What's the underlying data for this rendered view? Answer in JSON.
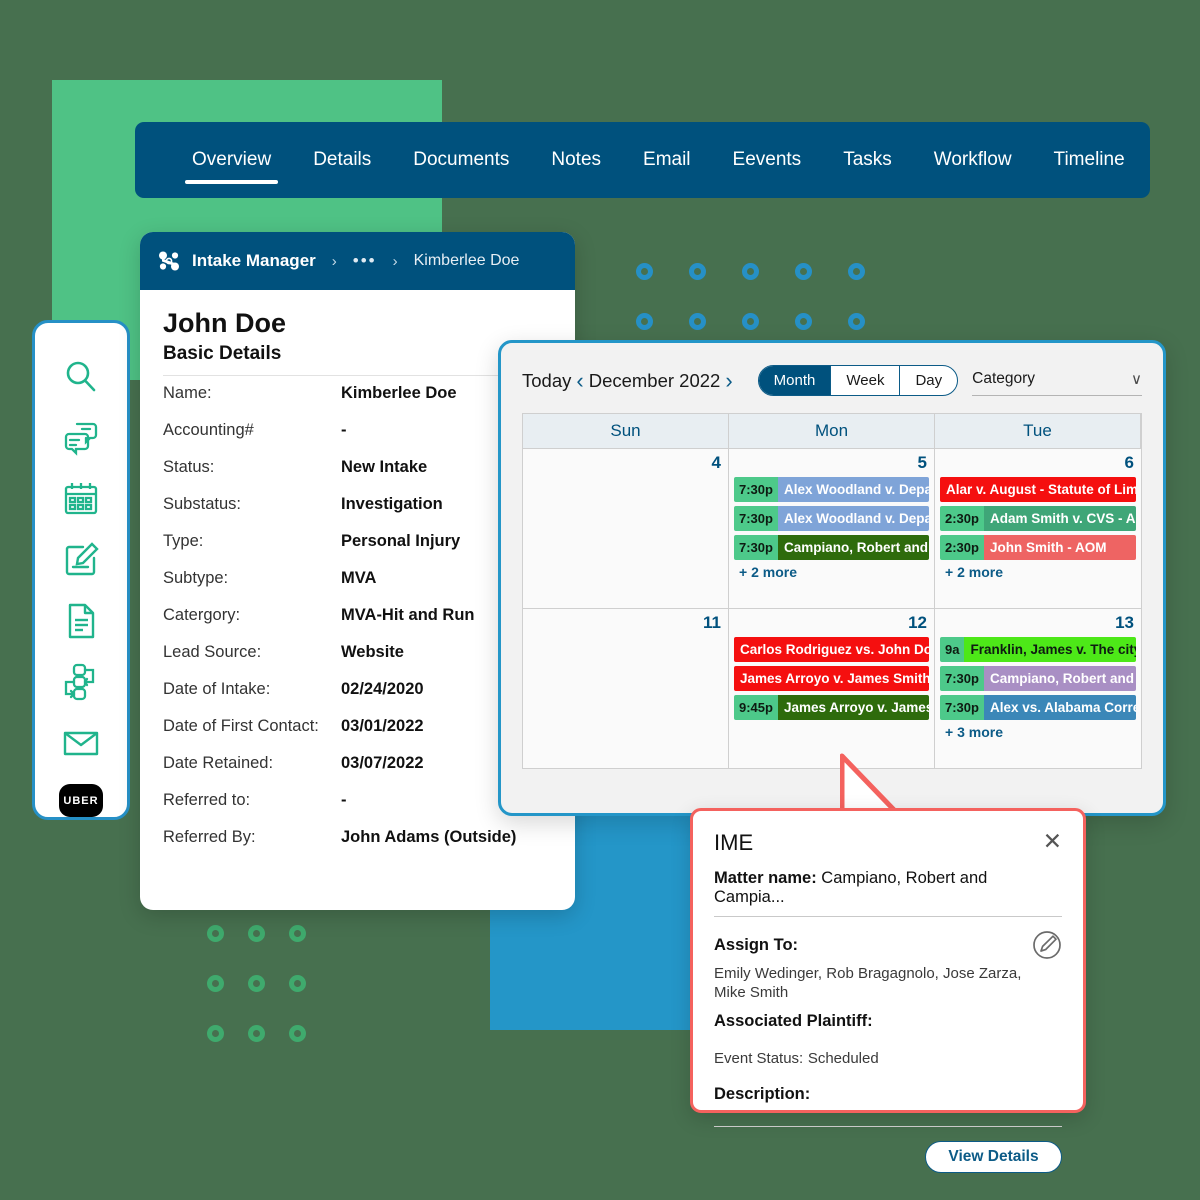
{
  "theme": {
    "page_bg": "#47704F",
    "navy": "#00517D",
    "blue": "#2496C8",
    "green": "#4FC285",
    "coral": "#F4625E",
    "mint": "#4DC98A"
  },
  "tabs": [
    {
      "label": "Overview",
      "active": true
    },
    {
      "label": "Details",
      "active": false
    },
    {
      "label": "Documents",
      "active": false
    },
    {
      "label": "Notes",
      "active": false
    },
    {
      "label": "Email",
      "active": false
    },
    {
      "label": "Eevents",
      "active": false
    },
    {
      "label": "Tasks",
      "active": false
    },
    {
      "label": "Workflow",
      "active": false
    },
    {
      "label": "Timeline",
      "active": false
    }
  ],
  "rail": {
    "items": [
      {
        "icon": "search-icon"
      },
      {
        "icon": "chat-bubbles-icon"
      },
      {
        "icon": "calendar-icon"
      },
      {
        "icon": "note-edit-icon"
      },
      {
        "icon": "document-icon"
      },
      {
        "icon": "workflow-icon"
      },
      {
        "icon": "envelope-icon"
      },
      {
        "icon": "uber-badge-icon",
        "label": "UBER"
      }
    ]
  },
  "intake": {
    "app_title": "Intake Manager",
    "crumb_dots": "•••",
    "crumb_leaf": "Kimberlee Doe",
    "person_name": "John Doe",
    "section_title": "Basic Details",
    "fields": [
      {
        "label": "Name:",
        "value": "Kimberlee Doe"
      },
      {
        "label": "Accounting#",
        "value": "-"
      },
      {
        "label": "Status:",
        "value": "New Intake"
      },
      {
        "label": "Substatus:",
        "value": "Investigation"
      },
      {
        "label": "Type:",
        "value": "Personal Injury"
      },
      {
        "label": "Subtype:",
        "value": "MVA"
      },
      {
        "label": "Catergory:",
        "value": "MVA-Hit and Run"
      },
      {
        "label": "Lead Source:",
        "value": "Website"
      },
      {
        "label": "Date of Intake:",
        "value": "02/24/2020"
      },
      {
        "label": "Date of First Contact:",
        "value": "03/01/2022"
      },
      {
        "label": "Date Retained:",
        "value": "03/07/2022"
      },
      {
        "label": "Referred to:",
        "value": "-"
      },
      {
        "label": "Referred By:",
        "value": "John Adams (Outside)"
      }
    ]
  },
  "calendar": {
    "today_label": "Today",
    "prev_label": "‹",
    "next_label": "›",
    "month_label": "December 2022",
    "views": [
      {
        "label": "Month",
        "active": true
      },
      {
        "label": "Week",
        "active": false
      },
      {
        "label": "Day",
        "active": false
      }
    ],
    "category_label": "Category",
    "category_chevron": "∨",
    "day_headers": [
      "Sun",
      "Mon",
      "Tue"
    ],
    "cells": [
      {
        "day": "4",
        "events": [],
        "more": ""
      },
      {
        "day": "5",
        "events": [
          {
            "time": "7:30p",
            "title": "Alex Woodland v. Depart",
            "bg": "#7FA4D8",
            "text_dark": false
          },
          {
            "time": "7:30p",
            "title": "Alex Woodland v. Depart",
            "bg": "#7FA4D8",
            "text_dark": false
          },
          {
            "time": "7:30p",
            "title": "Campiano, Robert and Ca",
            "bg": "#2E6B0C",
            "text_dark": false
          }
        ],
        "more": "+ 2 more"
      },
      {
        "day": "6",
        "events": [
          {
            "time": "",
            "title": "Alar v. August - Statute of Limitat",
            "bg": "#F50F0F",
            "text_dark": false
          },
          {
            "time": "2:30p",
            "title": "Adam Smith v. CVS - Arbit",
            "bg": "#3FA678",
            "text_dark": false
          },
          {
            "time": "2:30p",
            "title": "John Smith - AOM",
            "bg": "#EE6463",
            "text_dark": false
          }
        ],
        "more": "+ 2 more"
      },
      {
        "day": "11",
        "events": [],
        "more": ""
      },
      {
        "day": "12",
        "events": [
          {
            "time": "",
            "title": "Carlos Rodriguez vs. John Doe - S",
            "bg": "#F50F0F",
            "text_dark": false
          },
          {
            "time": "",
            "title": "James Arroyo v. James Smith - St",
            "bg": "#F50F0F",
            "text_dark": false
          },
          {
            "time": "9:45p",
            "title": "James Arroyo v. James Sm",
            "bg": "#2E6B0C",
            "text_dark": false
          }
        ],
        "more": ""
      },
      {
        "day": "13",
        "events": [
          {
            "time": "9a",
            "title": "Franklin, James v. The city of",
            "bg": "#4DE818",
            "text_dark": true
          },
          {
            "time": "7:30p",
            "title": "Campiano, Robert and Ca",
            "bg": "#A98FC4",
            "text_dark": false
          },
          {
            "time": "7:30p",
            "title": "Alex vs. Alabama Correctio",
            "bg": "#3B87B8",
            "text_dark": false
          }
        ],
        "more": "+ 3 more"
      }
    ]
  },
  "ime": {
    "title": "IME",
    "close_glyph": "✕",
    "matter_label": "Matter name:",
    "matter_value": "Campiano, Robert and Campia...",
    "assign_label": "Assign To:",
    "assignees": "Emily Wedinger, Rob Bragagnolo, Jose Zarza, Mike Smith",
    "plaintiff_label": "Associated Plaintiff:",
    "status_label": "Event Status:",
    "status_value": "Scheduled",
    "description_label": "Description:",
    "view_details_label": "View Details"
  }
}
